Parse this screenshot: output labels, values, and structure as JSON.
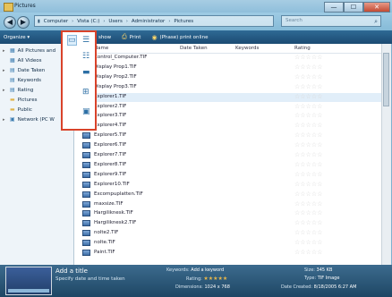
{
  "window": {
    "title": "Pictures",
    "minimize": "—",
    "maximize": "☐",
    "close": "✕"
  },
  "address": {
    "crumbs": [
      "Computer",
      "Vista (C:)",
      "Users",
      "Administrator",
      "Pictures"
    ],
    "search_placeholder": "Search"
  },
  "toolbar": {
    "organize": "Organize ▾",
    "slideshow": "Slide show",
    "print": "Print",
    "burn": "(Phase) print online"
  },
  "sidebar": {
    "items": [
      {
        "label": "All Pictures and",
        "icon": "pictures-icon"
      },
      {
        "label": "All Videos",
        "icon": "videos-icon"
      },
      {
        "label": "Date Taken",
        "icon": "calendar-icon"
      },
      {
        "label": "Keywords",
        "icon": "tag-icon"
      },
      {
        "label": "Rating",
        "icon": "star-icon"
      },
      {
        "label": "Pictures",
        "icon": "folder-icon"
      },
      {
        "label": "Public",
        "icon": "folder-icon"
      },
      {
        "label": "Network (PC W",
        "icon": "network-icon"
      }
    ]
  },
  "columns": {
    "name": "Name",
    "date": "Date Taken",
    "keywords": "Keywords",
    "rating": "Rating"
  },
  "files": [
    "Control_Computer.TIF",
    "Display Prop1.TIF",
    "Display Prop2.TIF",
    "Display Prop3.TIF",
    "Explorer1.TIF",
    "Explorer2.TIF",
    "Explorer3.TIF",
    "Explorer4.TIF",
    "Explorer5.TIF",
    "Explorer6.TIF",
    "Explorer7.TIF",
    "Explorer8.TIF",
    "Explorer9.TIF",
    "Explorer10.TIF",
    "Excompuplatten.TIF",
    "maxsize.TIF",
    "Hargiliknesk.TIF",
    "Hargiliknesk2.TIF",
    "nolte2.TIF",
    "nolte.TIF",
    "Paint.TIF"
  ],
  "rating_stars": "☆☆☆☆☆",
  "details": {
    "title": "Add a title",
    "subtitle": "Specify date and time taken",
    "keywords_label": "Keywords:",
    "keywords_value": "Add a keyword",
    "rating_label": "Rating:",
    "rating_value": "★★★★★",
    "dimensions_label": "Dimensions:",
    "dimensions_value": "1024 x 768",
    "size_label": "Size:",
    "size_value": "345 KB",
    "type_label": "Type:",
    "type_value": "TIF Image",
    "date_label": "Date Created:",
    "date_value": "8/18/2005 6:27 AM"
  }
}
